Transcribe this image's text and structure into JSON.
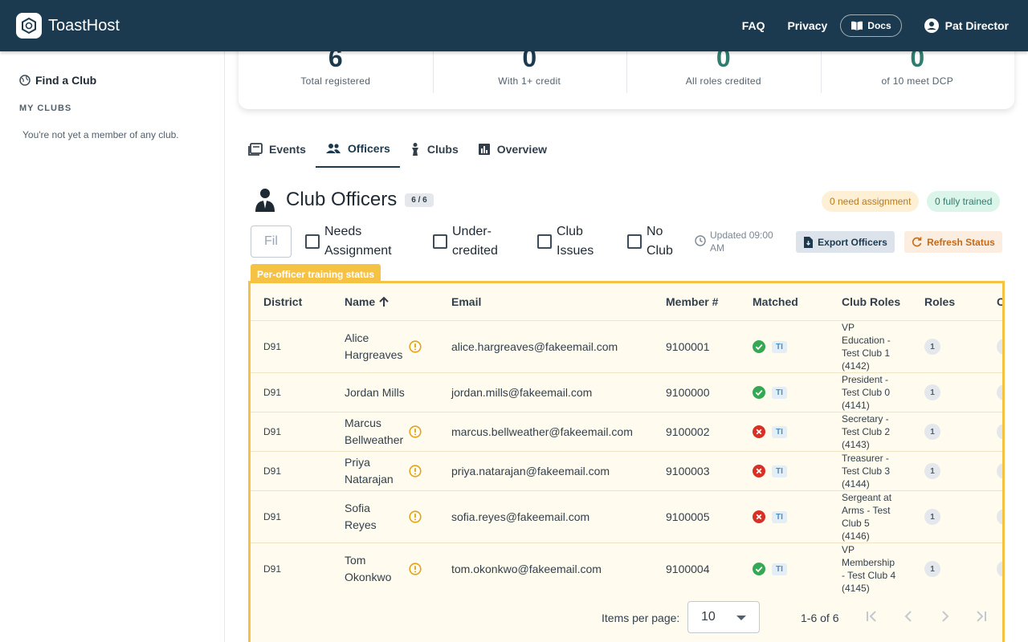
{
  "app": {
    "name": "ToastHost"
  },
  "nav": {
    "faq": "FAQ",
    "privacy": "Privacy",
    "docs": "Docs",
    "user": "Pat Director"
  },
  "sidebar": {
    "find_club": "Find a Club",
    "my_clubs_heading": "MY CLUBS",
    "no_club_message": "You're not yet a member of any club."
  },
  "stats": [
    {
      "value": "6",
      "label": "Total registered"
    },
    {
      "value": "0",
      "label": "With 1+ credit"
    },
    {
      "value": "0",
      "label": "All roles credited"
    },
    {
      "value": "0",
      "label": "of 10 meet DCP"
    }
  ],
  "tabs": [
    {
      "label": "Events",
      "icon": "event-note-icon"
    },
    {
      "label": "Officers",
      "icon": "people-icon",
      "active": true
    },
    {
      "label": "Clubs",
      "icon": "person-pin-icon"
    },
    {
      "label": "Overview",
      "icon": "bar-chart-icon"
    }
  ],
  "officers": {
    "title": "Club Officers",
    "count": "6 / 6",
    "need_assignment": "0 need assignment",
    "fully_trained": "0 fully trained",
    "filter_placeholder": "Fil",
    "filters": {
      "needs_assignment": "Needs Assignment",
      "under_credited": "Under-credited",
      "club_issues": "Club Issues",
      "no_club": "No Club"
    },
    "updated": "Updated 09:00 AM",
    "export_label": "Export Officers",
    "refresh_label": "Refresh Status",
    "status_tag": "Per-officer training status"
  },
  "table": {
    "headers": {
      "district": "District",
      "name": "Name",
      "email": "Email",
      "member": "Member #",
      "matched": "Matched",
      "club_roles": "Club Roles",
      "roles": "Roles",
      "c": "C"
    },
    "rows": [
      {
        "district": "D91",
        "name": "Alice Hargreaves",
        "warn": true,
        "email": "alice.hargreaves@fakeemail.com",
        "member": "9100001",
        "matched": true,
        "tag": "TI",
        "club_roles": "VP Education - Test Club 1 (4142)",
        "roles": "1"
      },
      {
        "district": "D91",
        "name": "Jordan Mills",
        "warn": false,
        "email": "jordan.mills@fakeemail.com",
        "member": "9100000",
        "matched": true,
        "tag": "TI",
        "club_roles": "President - Test Club 0 (4141)",
        "roles": "1"
      },
      {
        "district": "D91",
        "name": "Marcus Bellweather",
        "warn": true,
        "email": "marcus.bellweather@fakeemail.com",
        "member": "9100002",
        "matched": false,
        "tag": "TI",
        "club_roles": "Secretary - Test Club 2 (4143)",
        "roles": "1"
      },
      {
        "district": "D91",
        "name": "Priya Natarajan",
        "warn": true,
        "email": "priya.natarajan@fakeemail.com",
        "member": "9100003",
        "matched": false,
        "tag": "TI",
        "club_roles": "Treasurer - Test Club 3 (4144)",
        "roles": "1"
      },
      {
        "district": "D91",
        "name": "Sofia Reyes",
        "warn": true,
        "email": "sofia.reyes@fakeemail.com",
        "member": "9100005",
        "matched": false,
        "tag": "TI",
        "club_roles": "Sergeant at Arms - Test Club 5 (4146)",
        "roles": "1"
      },
      {
        "district": "D91",
        "name": "Tom Okonkwo",
        "warn": true,
        "email": "tom.okonkwo@fakeemail.com",
        "member": "9100004",
        "matched": true,
        "tag": "TI",
        "club_roles": "VP Membership - Test Club 4 (4145)",
        "roles": "1"
      }
    ]
  },
  "paginator": {
    "label": "Items per page:",
    "page_size": "10",
    "range": "1-6 of 6"
  },
  "colors": {
    "topbar": "#1b3a4f",
    "highlight": "#f6c244",
    "success": "#34a853",
    "error": "#d93025",
    "warning": "#e0a41b"
  }
}
